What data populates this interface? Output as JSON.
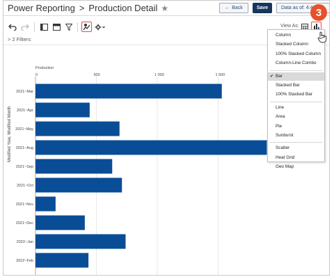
{
  "header": {
    "breadcrumb_root": "Power Reporting",
    "breadcrumb_sep": ">",
    "page_title": "Production Detail",
    "back_label": "Back",
    "save_label": "Save",
    "data_as_of": "Data as of: 4:4",
    "step_badge": "3"
  },
  "toolbar": {
    "view_as_label": "View As:"
  },
  "filters": {
    "label": "> 2 Filters"
  },
  "chart_data": {
    "type": "bar",
    "orientation": "horizontal",
    "series_color": "#0a4d97",
    "xlabel": "Production",
    "ylabel": "Modified Year, Modified Month",
    "x_ticks": [
      "0",
      "500",
      "1 000",
      "1 500"
    ],
    "xlim": [
      0,
      1750
    ],
    "grid": true,
    "categories": [
      "2021~Mar",
      "2021~Apr",
      "2021~May",
      "2021~Aug",
      "2021~Sep",
      "2021~Oct",
      "2021~Nov",
      "2021~Dec",
      "2022~Jan",
      "2022~Feb"
    ],
    "values": [
      1530,
      445,
      690,
      1900,
      630,
      710,
      165,
      405,
      740,
      435
    ]
  },
  "menu": {
    "groups": [
      [
        "Column",
        "Stacked Column",
        "100% Stacked Column",
        "Column-Line Combo"
      ],
      [
        "Bar",
        "Stacked Bar",
        "100% Stacked Bar"
      ],
      [
        "Line",
        "Area",
        "Pie",
        "Sunburst"
      ],
      [
        "Scatter",
        "Heat Grid",
        "Geo Map"
      ]
    ],
    "selected": "Bar"
  },
  "colors": {
    "bar": "#0a4d97",
    "save_bg": "#17365d",
    "badge": "#e8502a",
    "highlight_border": "#e24b4b"
  }
}
